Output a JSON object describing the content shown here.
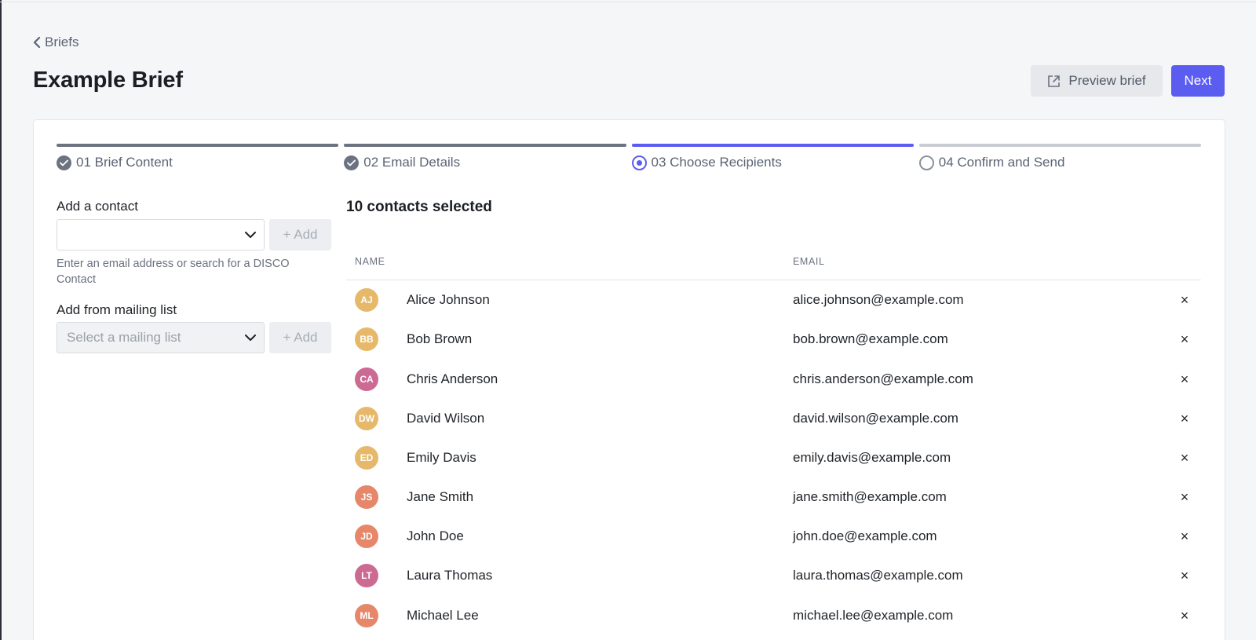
{
  "breadcrumb": {
    "label": "Briefs"
  },
  "page": {
    "title": "Example Brief"
  },
  "actions": {
    "preview_label": "Preview brief",
    "next_label": "Next"
  },
  "steps": [
    {
      "label": "01 Brief Content",
      "status": "done"
    },
    {
      "label": "02 Email Details",
      "status": "done"
    },
    {
      "label": "03 Choose Recipients",
      "status": "current"
    },
    {
      "label": "04 Confirm and Send",
      "status": "todo"
    }
  ],
  "sidebar": {
    "add_contact_label": "Add a contact",
    "contact_select_value": "",
    "add_button_label": "+ Add",
    "helper_text": "Enter an email address or search for a DISCO Contact",
    "mailing_list_label": "Add from mailing list",
    "mailing_list_placeholder": "Select a mailing list"
  },
  "recipients": {
    "heading": "10 contacts selected",
    "columns": {
      "name": "NAME",
      "email": "EMAIL"
    },
    "remove_symbol": "×",
    "rows": [
      {
        "initials": "AJ",
        "name": "Alice Johnson",
        "email": "alice.johnson@example.com",
        "color": "#e6b96a"
      },
      {
        "initials": "BB",
        "name": "Bob Brown",
        "email": "bob.brown@example.com",
        "color": "#e6b96a"
      },
      {
        "initials": "CA",
        "name": "Chris Anderson",
        "email": "chris.anderson@example.com",
        "color": "#cc6a93"
      },
      {
        "initials": "DW",
        "name": "David Wilson",
        "email": "david.wilson@example.com",
        "color": "#e6b96a"
      },
      {
        "initials": "ED",
        "name": "Emily Davis",
        "email": "emily.davis@example.com",
        "color": "#e6b96a"
      },
      {
        "initials": "JS",
        "name": "Jane Smith",
        "email": "jane.smith@example.com",
        "color": "#e6876a"
      },
      {
        "initials": "JD",
        "name": "John Doe",
        "email": "john.doe@example.com",
        "color": "#e6876a"
      },
      {
        "initials": "LT",
        "name": "Laura Thomas",
        "email": "laura.thomas@example.com",
        "color": "#cc6a93"
      },
      {
        "initials": "ML",
        "name": "Michael Lee",
        "email": "michael.lee@example.com",
        "color": "#e6876a"
      }
    ]
  },
  "colors": {
    "accent": "#5b5cf0",
    "muted": "#6b7380"
  }
}
